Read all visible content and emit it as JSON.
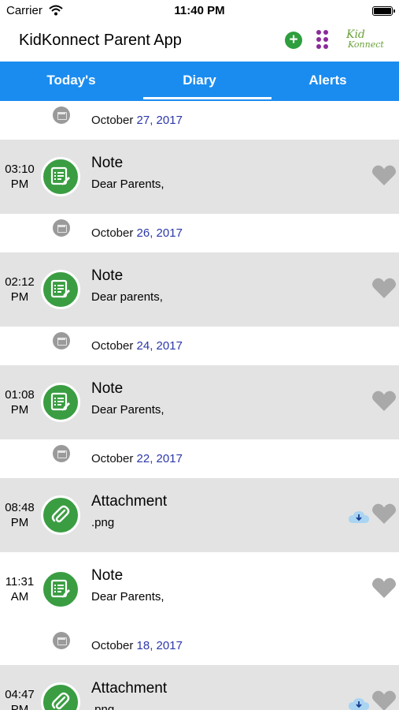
{
  "status_bar": {
    "carrier": "Carrier",
    "time": "11:40 PM"
  },
  "header": {
    "title": "KidKonnect Parent App",
    "add_icon": "plus-circle-icon",
    "grid_icon": "apps-grid-icon",
    "logo_kid": "Kid",
    "logo_konnect": "Konnect"
  },
  "tabs": [
    {
      "label": "Today's",
      "active": false
    },
    {
      "label": "Diary",
      "active": true
    },
    {
      "label": "Alerts",
      "active": false
    }
  ],
  "colors": {
    "accent": "#1a8cf0",
    "icon_green": "#3a9d42",
    "date_blue": "#2b37a8",
    "logo_purple": "#8a2b9a"
  },
  "timeline": [
    {
      "kind": "date",
      "month": "October",
      "day": "27, 2017"
    },
    {
      "kind": "entry",
      "bg": "grey",
      "time_hm": "03:10",
      "time_ampm": "PM",
      "icon": "note-icon",
      "title": "Note",
      "subtitle": "Dear Parents,",
      "download": false
    },
    {
      "kind": "date",
      "month": "October",
      "day": "26, 2017"
    },
    {
      "kind": "entry",
      "bg": "grey",
      "time_hm": "02:12",
      "time_ampm": "PM",
      "icon": "note-icon",
      "title": "Note",
      "subtitle": "Dear parents,",
      "download": false
    },
    {
      "kind": "date",
      "month": "October",
      "day": "24, 2017"
    },
    {
      "kind": "entry",
      "bg": "grey",
      "time_hm": "01:08",
      "time_ampm": "PM",
      "icon": "note-icon",
      "title": "Note",
      "subtitle": "Dear Parents,",
      "download": false
    },
    {
      "kind": "date",
      "month": "October",
      "day": "22, 2017"
    },
    {
      "kind": "entry",
      "bg": "grey",
      "time_hm": "08:48",
      "time_ampm": "PM",
      "icon": "attachment-icon",
      "title": "Attachment",
      "subtitle": ".png",
      "download": true
    },
    {
      "kind": "entry",
      "bg": "white",
      "time_hm": "11:31",
      "time_ampm": "AM",
      "icon": "note-icon",
      "title": "Note",
      "subtitle": "Dear Parents,",
      "download": false
    },
    {
      "kind": "date",
      "month": "October",
      "day": "18, 2017"
    },
    {
      "kind": "entry",
      "bg": "grey",
      "time_hm": "04:47",
      "time_ampm": "PM",
      "icon": "attachment-icon",
      "title": "Attachment",
      "subtitle": ".png",
      "download": true
    }
  ]
}
